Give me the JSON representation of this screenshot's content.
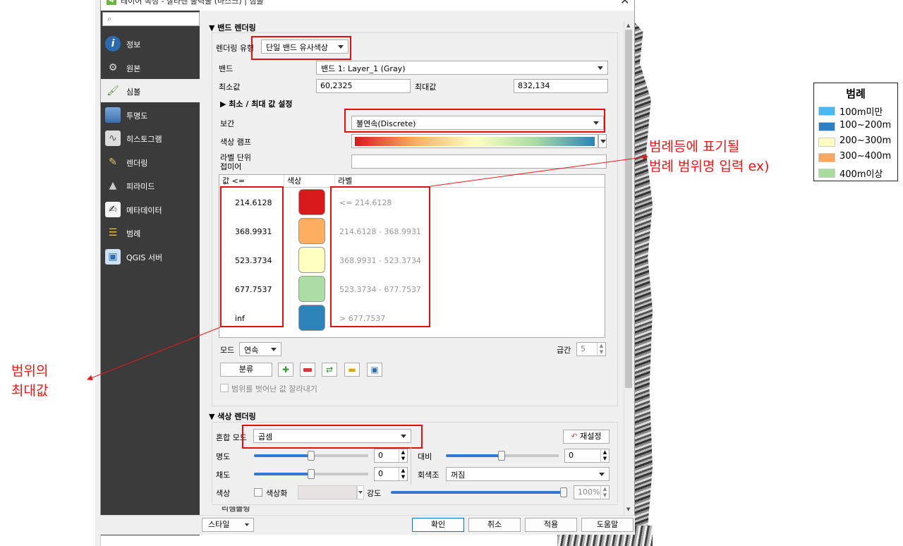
{
  "window": {
    "title": "레이어 속성 - 잘라낸 출력물 (마스크) | 심볼",
    "app_icon": "Q",
    "close": "✕"
  },
  "sidebar": {
    "search_icon": "⌕",
    "items": [
      {
        "label": "정보",
        "icon": "info-icon"
      },
      {
        "label": "원본",
        "icon": "source-icon"
      },
      {
        "label": "심볼",
        "icon": "symbology-icon"
      },
      {
        "label": "투명도",
        "icon": "transparency-icon"
      },
      {
        "label": "히스토그램",
        "icon": "histogram-icon"
      },
      {
        "label": "렌더링",
        "icon": "rendering-icon"
      },
      {
        "label": "피라미드",
        "icon": "pyramid-icon"
      },
      {
        "label": "메타데이터",
        "icon": "metadata-icon"
      },
      {
        "label": "범례",
        "icon": "legend-icon"
      },
      {
        "label": "QGIS 서버",
        "icon": "server-icon"
      }
    ],
    "active_index": 2
  },
  "band_render": {
    "section_title": "밴드 렌더링",
    "render_type_label": "렌더링 유형",
    "render_type_value": "단일 밴드 유사색상",
    "band_label": "밴드",
    "band_value": "밴드 1: Layer_1 (Gray)",
    "min_label": "최소값",
    "min_value": "60,2325",
    "max_label": "최대값",
    "max_value": "832,134",
    "minmax_settings": "최소 / 최대 값 설정",
    "interp_label": "보간",
    "interp_value": "불연속(Discrete)",
    "ramp_label": "색상 램프",
    "unit_label_1": "라벨 단위",
    "unit_label_2": "접미어",
    "table_headers": [
      "값 <=",
      "색상",
      "라벨"
    ],
    "rows": [
      {
        "value": "214.6128",
        "color": "#d7191c",
        "label": "<= 214.6128"
      },
      {
        "value": "368.9931",
        "color": "#fdae61",
        "label": "214.6128 - 368.9931"
      },
      {
        "value": "523.3734",
        "color": "#ffffbf",
        "label": "368.9931 - 523.3734"
      },
      {
        "value": "677.7537",
        "color": "#abdda4",
        "label": "523.3734 - 677.7537"
      },
      {
        "value": "inf",
        "color": "#2b83ba",
        "label": "> 677.7537"
      }
    ],
    "mode_label": "모드",
    "mode_value": "연속",
    "classes_label": "급간",
    "classes_value": "5",
    "classify_button": "분류",
    "clip_label": "범위를 벗어난 값 잘라내기"
  },
  "color_render": {
    "section_title": "색상 렌더링",
    "blend_label": "혼합 모드",
    "blend_value": "곱셈",
    "reset_button": "재설정",
    "brightness_label": "명도",
    "brightness_value": "0",
    "contrast_label": "대비",
    "contrast_value": "0",
    "saturation_label": "채도",
    "saturation_value": "0",
    "grayscale_label": "회색조",
    "grayscale_value": "꺼짐",
    "hue_label": "색상",
    "colorize_label": "색상화",
    "strength_label": "강도",
    "strength_value": "100%",
    "more_label": "리샘플링"
  },
  "footer": {
    "style_button": "스타일",
    "ok_button": "확인",
    "cancel_button": "취소",
    "apply_button": "적용",
    "help_button": "도움말"
  },
  "annotations": {
    "right_1": "범례등에 표기될",
    "right_2": "범례 범위명 입력 ex)",
    "left_1": "범위의",
    "left_2": "최대값"
  },
  "legend": {
    "title": "범례",
    "items": [
      {
        "label": "100m미만",
        "color": "#4db8f0"
      },
      {
        "label": "100~200m",
        "color": "#2e7fc1"
      },
      {
        "label": "200~300m",
        "color": "#ffffc0"
      },
      {
        "label": "300~400m",
        "color": "#f7a862"
      },
      {
        "label": "400m이상",
        "color": "#a8dc9c"
      }
    ]
  }
}
